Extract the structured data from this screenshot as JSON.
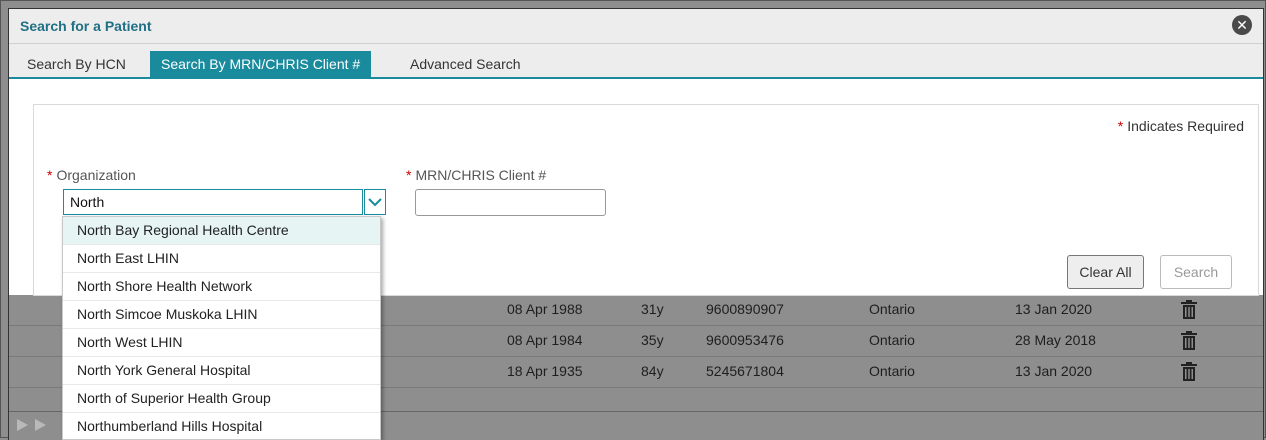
{
  "dialog": {
    "title": "Search for a Patient",
    "close_icon": "close-icon"
  },
  "tabs": [
    {
      "label": "Search By HCN",
      "active": false
    },
    {
      "label": "Search By MRN/CHRIS Client #",
      "active": true
    },
    {
      "label": "Advanced Search",
      "active": false
    }
  ],
  "form": {
    "required_star": "*",
    "required_note": "Indicates Required",
    "organization_label": "Organization",
    "organization_value": "North",
    "mrn_label": "MRN/CHRIS Client #",
    "mrn_value": "",
    "clear_label": "Clear All",
    "search_label": "Search"
  },
  "dropdown": {
    "options": [
      "North Bay Regional Health Centre",
      "North East LHIN",
      "North Shore Health Network",
      "North Simcoe Muskoka LHIN",
      "North West LHIN",
      "North York General Hospital",
      "North of Superior Health Group",
      "Northumberland Hills Hospital"
    ],
    "highlighted_index": 0
  },
  "results": [
    {
      "dob": "08 Apr 1988",
      "age": "31y",
      "hcn": "9600890907",
      "province": "Ontario",
      "date": "13 Jan 2020"
    },
    {
      "dob": "08 Apr 1984",
      "age": "35y",
      "hcn": "9600953476",
      "province": "Ontario",
      "date": "28 May 2018"
    },
    {
      "dob": "18 Apr 1935",
      "age": "84y",
      "hcn": "5245671804",
      "province": "Ontario",
      "date": "13 Jan 2020"
    }
  ],
  "colors": {
    "accent": "#1a8a9d",
    "title": "#1f6f85",
    "required": "#cc0000",
    "overlay": "#8e8e8e"
  }
}
